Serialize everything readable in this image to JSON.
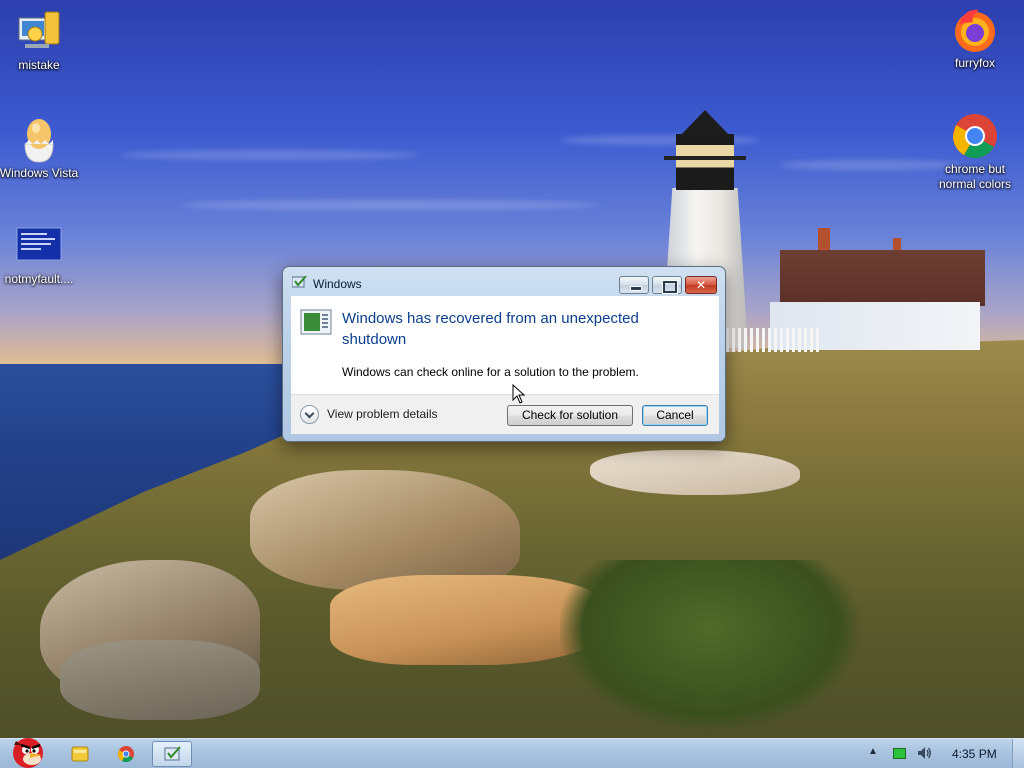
{
  "desktop": {
    "icons": [
      {
        "label": "mistake",
        "icon": "installer-icon"
      },
      {
        "label": "Windows Vista",
        "icon": "egg-icon"
      },
      {
        "label": "notmyfault....",
        "icon": "bluescreen-icon"
      },
      {
        "label": "furryfox",
        "icon": "firefox-icon"
      },
      {
        "label": "chrome but normal colors",
        "icon": "chrome-icon"
      }
    ]
  },
  "dialog": {
    "title": "Windows",
    "heading": "Windows has recovered from an unexpected shutdown",
    "message": "Windows can check online for a solution to the problem.",
    "details_label": "View problem details",
    "check_button": "Check for solution",
    "cancel_button": "Cancel"
  },
  "taskbar": {
    "items": [
      "start-angry-bird-icon",
      "explorer-icon",
      "chrome-icon",
      "app-icon"
    ],
    "clock": "4:35 PM"
  },
  "colors": {
    "dialog_heading": "#0b3e8c",
    "taskbar": "#a9c3df",
    "close_button": "#c03a22"
  }
}
